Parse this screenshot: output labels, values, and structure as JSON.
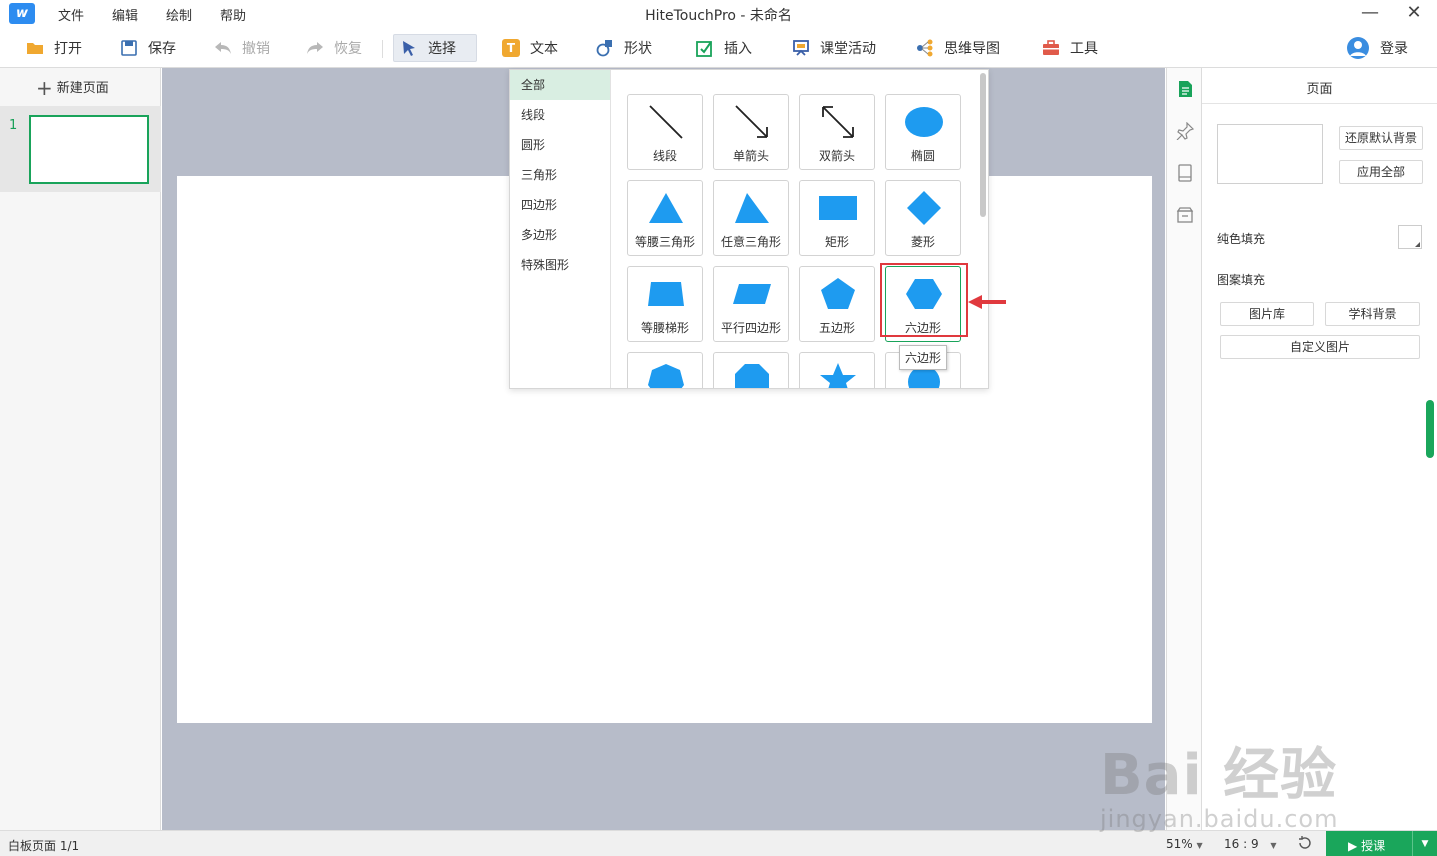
{
  "app": {
    "title": "HiteTouchPro - 未命名",
    "menu": [
      "文件",
      "编辑",
      "绘制",
      "帮助"
    ],
    "minimize": "—",
    "close": "✕"
  },
  "toolbar": {
    "open": "打开",
    "save": "保存",
    "undo": "撤销",
    "redo": "恢复",
    "select": "选择",
    "text": "文本",
    "shape": "形状",
    "insert": "插入",
    "classroom": "课堂活动",
    "mindmap": "思维导图",
    "tools": "工具",
    "login": "登录"
  },
  "pages_panel": {
    "new_page": "新建页面",
    "pages": [
      {
        "number": "1"
      }
    ]
  },
  "shape_popup": {
    "categories": [
      "全部",
      "线段",
      "圆形",
      "三角形",
      "四边形",
      "多边形",
      "特殊图形"
    ],
    "selected_category": "全部",
    "shapes": [
      "线段",
      "单箭头",
      "双箭头",
      "椭圆",
      "等腰三角形",
      "任意三角形",
      "矩形",
      "菱形",
      "等腰梯形",
      "平行四边形",
      "五边形",
      "六边形"
    ],
    "hovered_shape": "六边形",
    "tooltip": "六边形",
    "shape_color": "#1e9bf0"
  },
  "right_panel": {
    "title": "页面",
    "restore_bg": "还原默认背景",
    "apply_all": "应用全部",
    "solid_fill": "纯色填充",
    "pattern_fill": "图案填充",
    "image_library": "图片库",
    "subject_bg": "学科背景",
    "custom_image": "自定义图片"
  },
  "status": {
    "page_info": "白板页面 1/1",
    "zoom": "51%",
    "ratio": "16 : 9",
    "lecture": "授课"
  },
  "watermark": {
    "brand": "Bai 经验",
    "url": "jingyan.baidu.com"
  },
  "colors": {
    "accent_green": "#1aa65b",
    "shape_blue": "#1e9bf0",
    "highlight_red": "#e0393e",
    "canvas_gray": "#b7bcc9"
  }
}
